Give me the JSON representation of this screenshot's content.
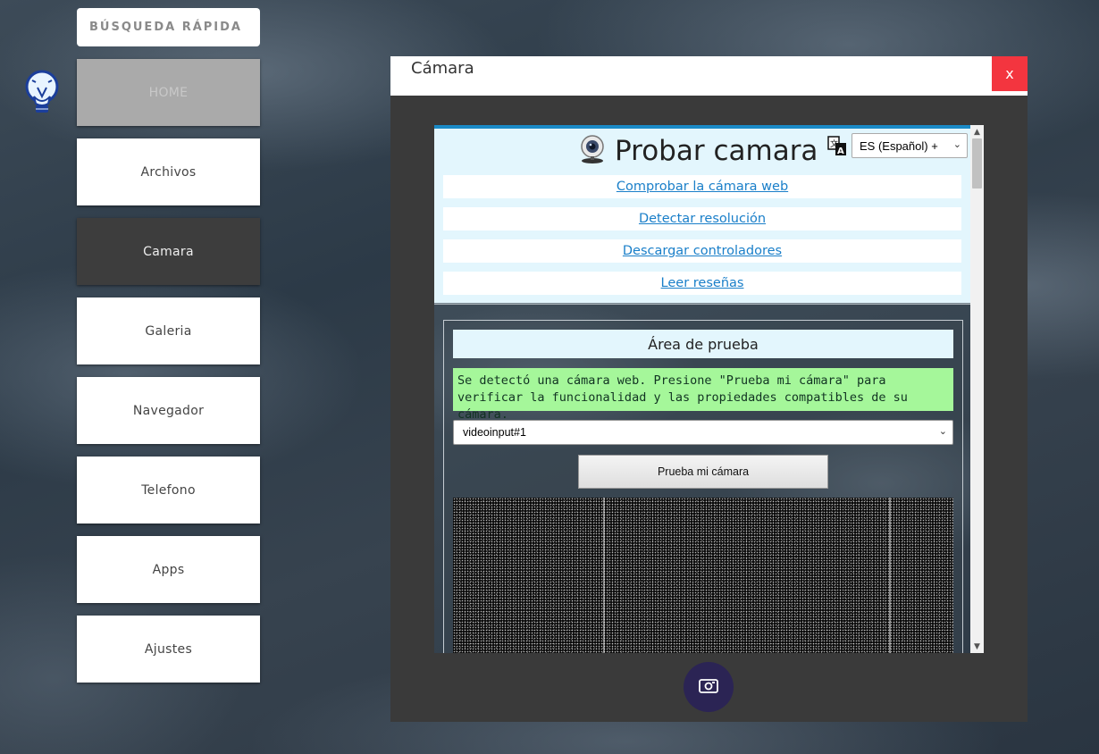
{
  "sidebar": {
    "quick_search": "BÚSQUEDA RÁPIDA",
    "items": [
      {
        "label": "HOME"
      },
      {
        "label": "Archivos"
      },
      {
        "label": "Camara"
      },
      {
        "label": "Galeria"
      },
      {
        "label": "Navegador"
      },
      {
        "label": "Telefono"
      },
      {
        "label": "Apps"
      },
      {
        "label": "Ajustes"
      }
    ]
  },
  "window": {
    "title": "Cámara",
    "close_label": "x"
  },
  "page": {
    "heading": "Probar camara",
    "language": "ES (Español) +",
    "links": [
      "Comprobar la cámara web",
      "Detectar resolución",
      "Descargar controladores",
      "Leer reseñas"
    ],
    "test_area": {
      "title": "Área de prueba",
      "message": "Se detectó una cámara web. Presione \"Prueba mi cámara\" para verificar la funcionalidad y las propiedades compatibles de su cámara.",
      "device": "videoinput#1",
      "button_label": "Prueba mi cámara"
    }
  },
  "icons": {
    "logo": "lightbulb-icon",
    "heading": "webcam-icon",
    "translate": "translate-icon",
    "capture": "camera-icon"
  },
  "colors": {
    "active_nav": "#3d3d3d",
    "close": "#f3353f",
    "link": "#1a7fc9",
    "success": "#a5f79a",
    "capture_button": "#2b2454"
  }
}
